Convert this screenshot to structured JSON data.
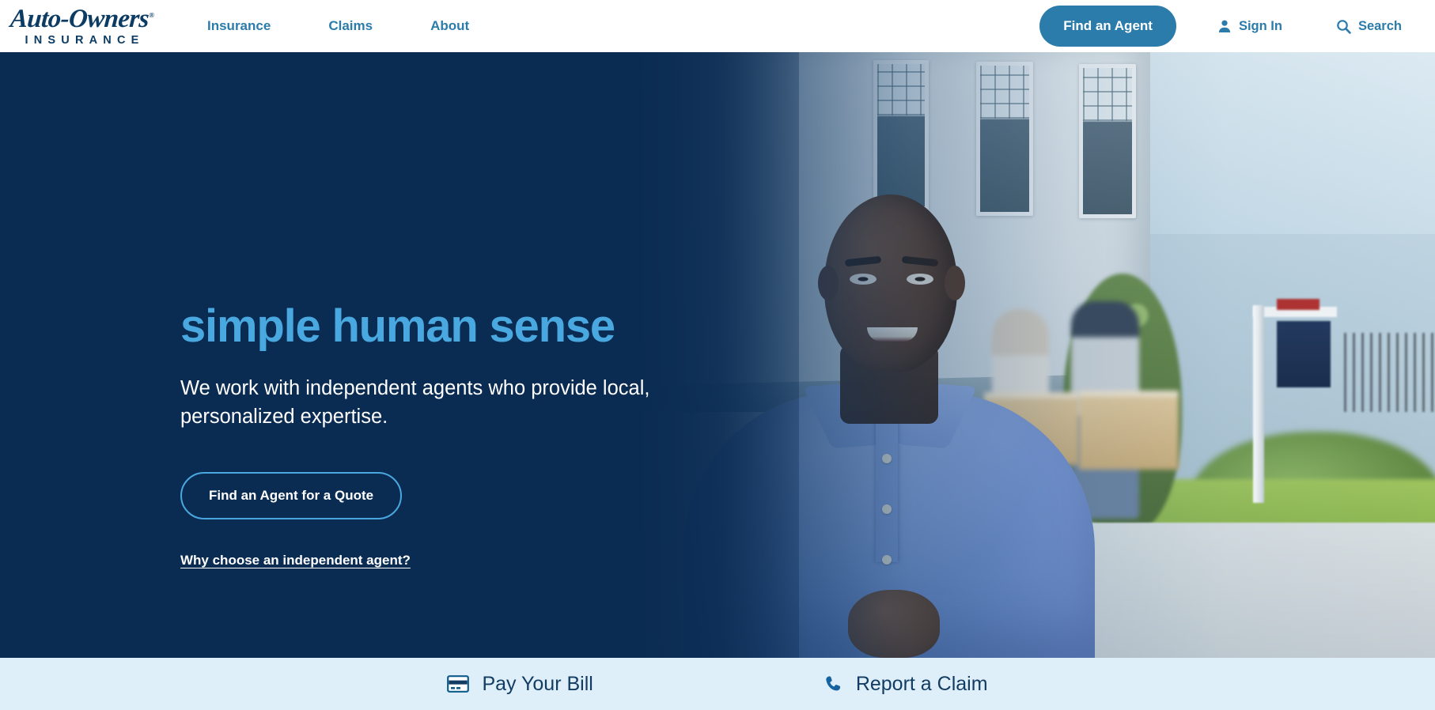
{
  "header": {
    "logo": {
      "script": "Auto-Owners",
      "trademark": "®",
      "subtitle": "INSURANCE"
    },
    "nav": [
      {
        "label": "Insurance"
      },
      {
        "label": "Claims"
      },
      {
        "label": "About"
      }
    ],
    "find_agent_button": "Find an Agent",
    "sign_in": "Sign In",
    "search": "Search",
    "icons": {
      "user": "user-icon",
      "search": "search-icon"
    },
    "colors": {
      "brand_blue": "#2B7CAB",
      "logo_navy": "#0C3C63",
      "background": "#FFFFFF"
    }
  },
  "hero": {
    "title": "simple human sense",
    "subtitle": "We work with independent agents who provide local, personalized expertise.",
    "cta_button": "Find an Agent for a Quote",
    "secondary_link": "Why choose an independent agent?",
    "colors": {
      "background_navy": "#0A2B52",
      "title_blue": "#49A8DF",
      "text_white": "#FFFFFF"
    },
    "image_description": "Smiling man in light blue polo shirt standing in front of a house; blurred background shows a couple carrying moving boxes and a real-estate sign"
  },
  "quickbar": {
    "items": [
      {
        "label": "Pay Your Bill",
        "icon": "credit-card-icon"
      },
      {
        "label": "Report a Claim",
        "icon": "phone-icon"
      }
    ],
    "colors": {
      "background": "#DEEFF9",
      "text": "#133C63"
    }
  }
}
